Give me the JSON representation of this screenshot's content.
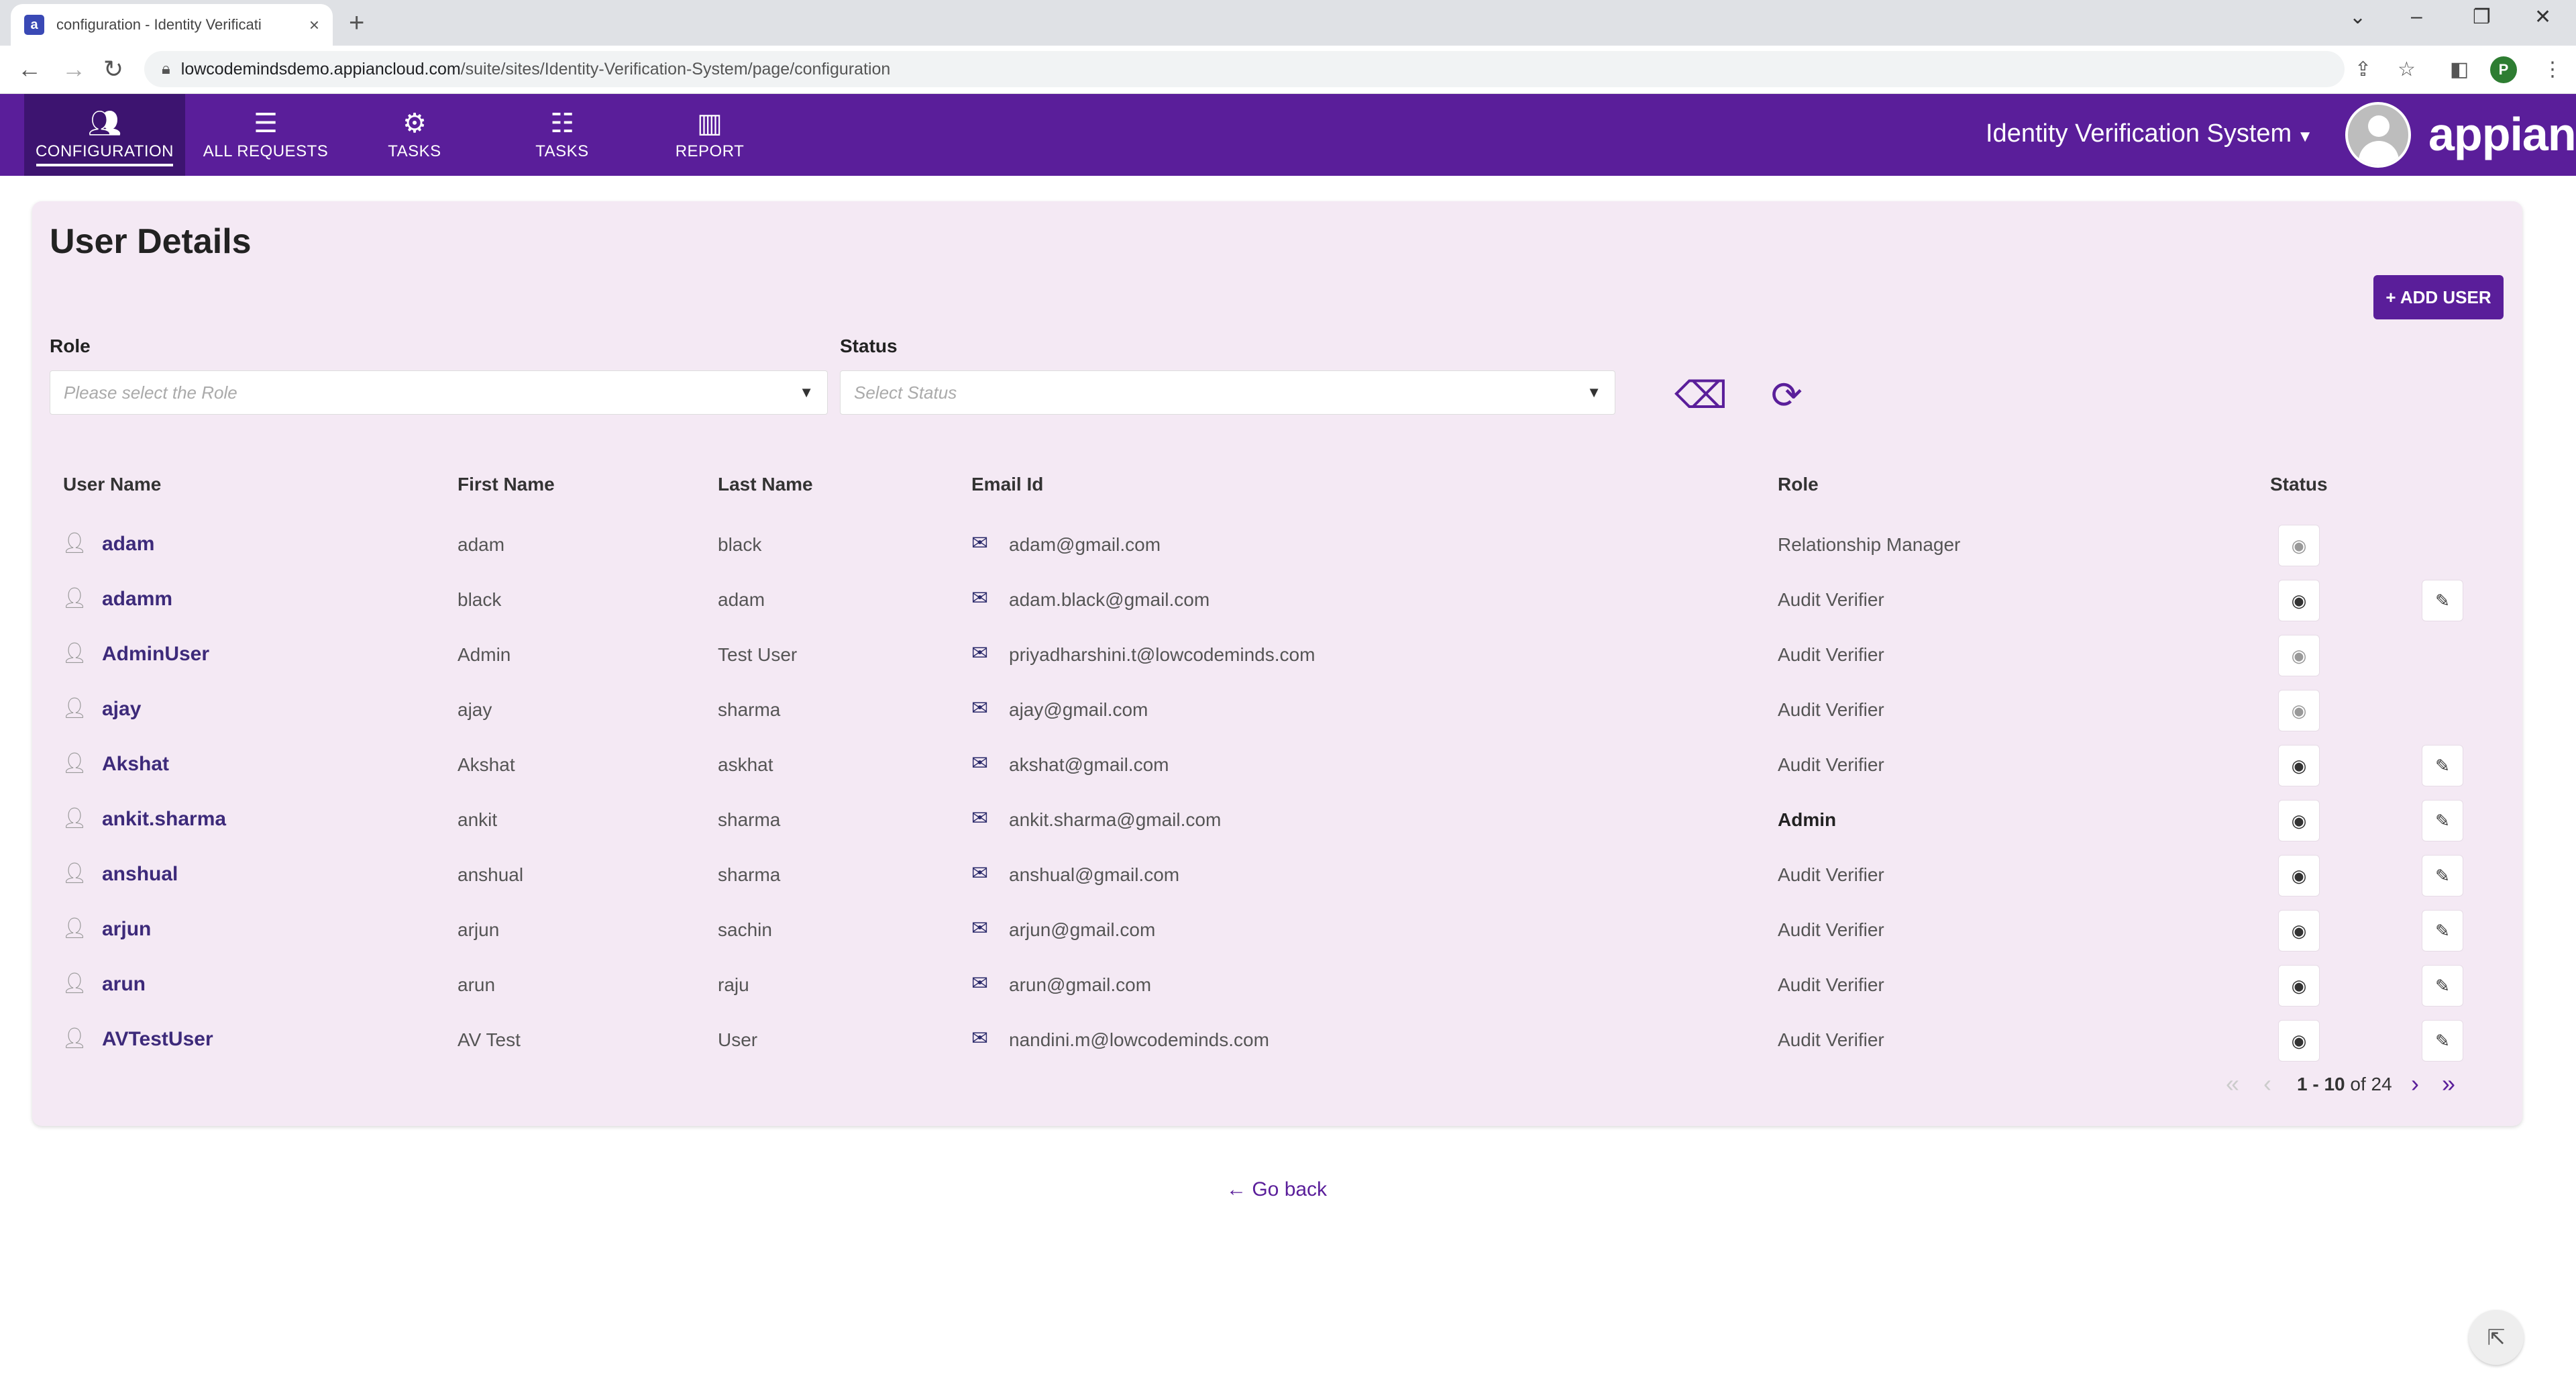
{
  "browser": {
    "tab_title": "configuration - Identity Verificati",
    "tab_close": "×",
    "new_tab": "+",
    "url_host": "lowcodemindsdemo.appiancloud.com",
    "url_path": "/suite/sites/Identity-Verification-System/page/configuration",
    "profile_initial": "P"
  },
  "nav": {
    "items": [
      {
        "label": "CONFIGURATION",
        "icon": "users-gear-icon"
      },
      {
        "label": "ALL REQUESTS",
        "icon": "list-check-icon"
      },
      {
        "label": "TASKS",
        "icon": "gear-icon"
      },
      {
        "label": "TASKS",
        "icon": "list-icon"
      },
      {
        "label": "REPORT",
        "icon": "bar-chart-icon"
      }
    ],
    "site_name": "Identity Verification System",
    "brand": "appian"
  },
  "page": {
    "title": "User Details",
    "add_user_label": "+ ADD USER",
    "role_label": "Role",
    "role_placeholder": "Please select the Role",
    "status_label": "Status",
    "status_placeholder": "Select Status"
  },
  "table": {
    "headers": [
      "User Name",
      "First Name",
      "Last Name",
      "Email Id",
      "Role",
      "Status"
    ],
    "rows": [
      {
        "username": "adam",
        "first": "adam",
        "last": "black",
        "email": "adam@gmail.com",
        "role": "Relationship Manager",
        "editable": false
      },
      {
        "username": "adamm",
        "first": "black",
        "last": "adam",
        "email": "adam.black@gmail.com",
        "role": "Audit Verifier",
        "editable": true
      },
      {
        "username": "AdminUser",
        "first": "Admin",
        "last": "Test User",
        "email": "priyadharshini.t@lowcodeminds.com",
        "role": "Audit Verifier",
        "editable": false
      },
      {
        "username": "ajay",
        "first": "ajay",
        "last": "sharma",
        "email": "ajay@gmail.com",
        "role": "Audit Verifier",
        "editable": false
      },
      {
        "username": "Akshat",
        "first": "Akshat",
        "last": "askhat",
        "email": "akshat@gmail.com",
        "role": "Audit Verifier",
        "editable": true
      },
      {
        "username": "ankit.sharma",
        "first": "ankit",
        "last": "sharma",
        "email": "ankit.sharma@gmail.com",
        "role": "Admin",
        "editable": true
      },
      {
        "username": "anshual",
        "first": "anshual",
        "last": "sharma",
        "email": "anshual@gmail.com",
        "role": "Audit Verifier",
        "editable": true
      },
      {
        "username": "arjun",
        "first": "arjun",
        "last": "sachin",
        "email": "arjun@gmail.com",
        "role": "Audit Verifier",
        "editable": true
      },
      {
        "username": "arun",
        "first": "arun",
        "last": "raju",
        "email": "arun@gmail.com",
        "role": "Audit Verifier",
        "editable": true
      },
      {
        "username": "AVTestUser",
        "first": "AV Test",
        "last": "User",
        "email": "nandini.m@lowcodeminds.com",
        "role": "Audit Verifier",
        "editable": true
      }
    ]
  },
  "pagination": {
    "range": "1 - 10",
    "of_label": "of 24"
  },
  "footer": {
    "go_back": "← Go back"
  }
}
